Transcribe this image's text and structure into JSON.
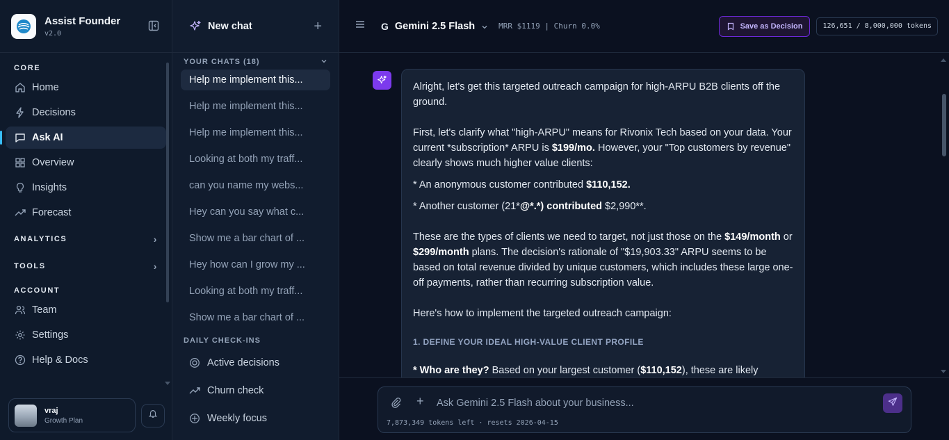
{
  "brand": {
    "name": "Assist Founder",
    "version": "v2.0"
  },
  "nav": {
    "core_label": "CORE",
    "core_items": [
      {
        "label": "Home",
        "icon": "home-icon"
      },
      {
        "label": "Decisions",
        "icon": "bolt-icon"
      },
      {
        "label": "Ask AI",
        "icon": "chat-icon",
        "active": true
      },
      {
        "label": "Overview",
        "icon": "grid-icon"
      },
      {
        "label": "Insights",
        "icon": "bulb-icon"
      },
      {
        "label": "Forecast",
        "icon": "trend-icon"
      }
    ],
    "analytics_label": "ANALYTICS",
    "tools_label": "TOOLS",
    "account_label": "ACCOUNT",
    "account_items": [
      {
        "label": "Team",
        "icon": "users-icon"
      },
      {
        "label": "Settings",
        "icon": "gear-icon"
      },
      {
        "label": "Help & Docs",
        "icon": "help-icon"
      }
    ]
  },
  "user": {
    "name": "vraj",
    "plan": "Growth Plan"
  },
  "chats": {
    "new_chat_label": "New chat",
    "header": "YOUR CHATS (18)",
    "items": [
      "Help me implement this...",
      "Help me implement this...",
      "Help me implement this...",
      "Looking at both my traff...",
      "can you name my webs...",
      "Hey can you say what c...",
      "Show me a bar chart of ...",
      "Hey how can I grow my ...",
      "Looking at both my traff...",
      "Show me a bar chart of ..."
    ],
    "checkins_header": "DAILY CHECK-INS",
    "checkins": [
      "Active decisions",
      "Churn check",
      "Weekly focus"
    ]
  },
  "topbar": {
    "model_mark": "G",
    "model": "Gemini 2.5 Flash",
    "metrics": "MRR $1119 | Churn 0.0%",
    "save_label": "Save as Decision",
    "tokens": "126,651 / 8,000,000 tokens"
  },
  "message": {
    "p1": "Alright, let's get this targeted outreach campaign for high-ARPU B2B clients off the ground.",
    "p2a": "First, let's clarify what \"high-ARPU\" means for Rivonix Tech based on your data. Your current *subscription* ARPU is ",
    "p2b": "$199/mo.",
    "p2c": " However, your \"Top customers by revenue\" clearly shows much higher value clients:",
    "p3a": "* An anonymous customer contributed ",
    "p3b": "$110,152.",
    "p4a": "* Another customer (21*",
    "p4b": "@*.*) contributed",
    "p4c": " $2,990**.",
    "p5a": "These are the types of clients we need to target, not just those on the ",
    "p5b": "$149/month",
    "p5c": " or ",
    "p5d": "$299/month",
    "p5e": " plans. The decision's rationale of \"$19,903.33\" ARPU seems to be based on total revenue divided by unique customers, which includes these large one-off payments, rather than recurring subscription value.",
    "p6": "Here's how to implement the targeted outreach campaign:",
    "section1": "1. DEFINE YOUR IDEAL HIGH-VALUE CLIENT PROFILE",
    "p7a": "* Who are they?",
    "p7b": " Based on your largest customer (",
    "p7c": "$110,152",
    "p7d": "), these are likely"
  },
  "composer": {
    "placeholder": "Ask Gemini 2.5 Flash about your business...",
    "tokens_left": "7,873,349 tokens left · resets 2026-04-15"
  }
}
